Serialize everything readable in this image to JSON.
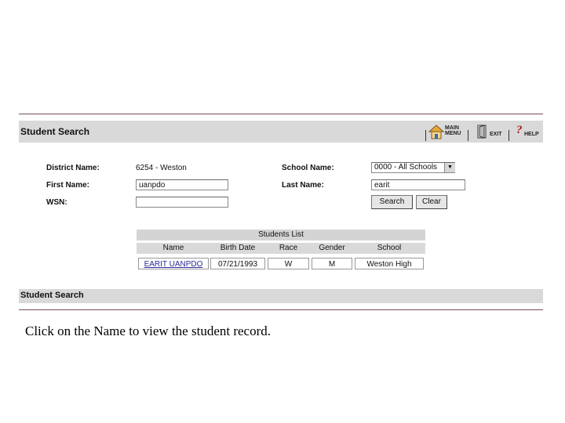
{
  "header": {
    "title": "Student Search",
    "main_menu_line1": "MAIN",
    "main_menu_line2": "MENU",
    "exit_label": "EXIT",
    "help_label": "HELP"
  },
  "form": {
    "district_label": "District Name:",
    "district_value": "6254 - Weston",
    "school_label": "School Name:",
    "school_value": "0000 - All Schools",
    "first_name_label": "First Name:",
    "first_name_value": "uanpdo",
    "last_name_label": "Last Name:",
    "last_name_value": "earit",
    "wsn_label": "WSN:",
    "wsn_value": "",
    "search_button": "Search",
    "clear_button": "Clear"
  },
  "students_list": {
    "caption": "Students List",
    "columns": [
      "Name",
      "Birth Date",
      "Race",
      "Gender",
      "School"
    ],
    "rows": [
      [
        "EARIT UANPDO",
        "07/21/1993",
        "W",
        "M",
        "Weston High"
      ]
    ]
  },
  "footer": {
    "title": "Student Search"
  },
  "instruction": "Click on the Name to view the student record."
}
